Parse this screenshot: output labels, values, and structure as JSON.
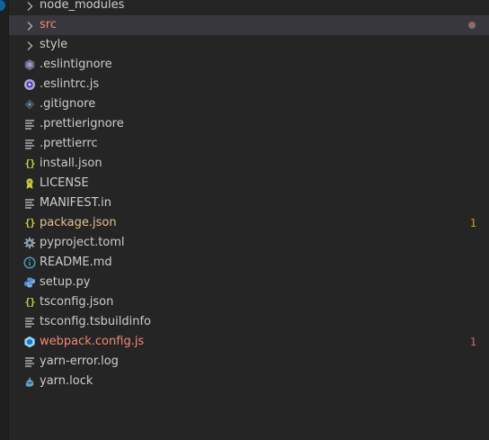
{
  "explorer": {
    "items": [
      {
        "label": "node_modules",
        "kind": "folder",
        "icon": "chevron-right-icon"
      },
      {
        "label": "src",
        "kind": "folder",
        "icon": "chevron-right-icon",
        "selected": true,
        "status": "error",
        "decoration_dot": "#8c6a6a"
      },
      {
        "label": "style",
        "kind": "folder",
        "icon": "chevron-right-icon"
      },
      {
        "label": ".eslintignore",
        "kind": "file",
        "icon": "eslint-icon"
      },
      {
        "label": ".eslintrc.js",
        "kind": "file",
        "icon": "eslint-config-icon"
      },
      {
        "label": ".gitignore",
        "kind": "file",
        "icon": "git-icon"
      },
      {
        "label": ".prettierignore",
        "kind": "file",
        "icon": "lines-icon"
      },
      {
        "label": ".prettierrc",
        "kind": "file",
        "icon": "lines-icon"
      },
      {
        "label": "install.json",
        "kind": "file",
        "icon": "json-icon"
      },
      {
        "label": "LICENSE",
        "kind": "file",
        "icon": "license-icon"
      },
      {
        "label": "MANIFEST.in",
        "kind": "file",
        "icon": "lines-icon"
      },
      {
        "label": "package.json",
        "kind": "file",
        "icon": "json-icon",
        "status": "modified",
        "count": "1",
        "count_color": "#cca700"
      },
      {
        "label": "pyproject.toml",
        "kind": "file",
        "icon": "gear-icon"
      },
      {
        "label": "README.md",
        "kind": "file",
        "icon": "info-icon"
      },
      {
        "label": "setup.py",
        "kind": "file",
        "icon": "python-icon"
      },
      {
        "label": "tsconfig.json",
        "kind": "file",
        "icon": "json-icon"
      },
      {
        "label": "tsconfig.tsbuildinfo",
        "kind": "file",
        "icon": "lines-icon"
      },
      {
        "label": "webpack.config.js",
        "kind": "file",
        "icon": "webpack-icon",
        "status": "error",
        "count": "1",
        "count_color": "#d16969"
      },
      {
        "label": "yarn-error.log",
        "kind": "file",
        "icon": "lines-icon"
      },
      {
        "label": "yarn.lock",
        "kind": "file",
        "icon": "yarn-icon"
      }
    ]
  },
  "colors": {
    "background": "#252526",
    "selected_row": "#37373d",
    "text": "#cccccc",
    "modified_text": "#e2c08d",
    "error_text": "#f48771",
    "json_icon": "#cbcb41",
    "webpack_icon": "#8ed6fb",
    "info_icon": "#519aba"
  }
}
